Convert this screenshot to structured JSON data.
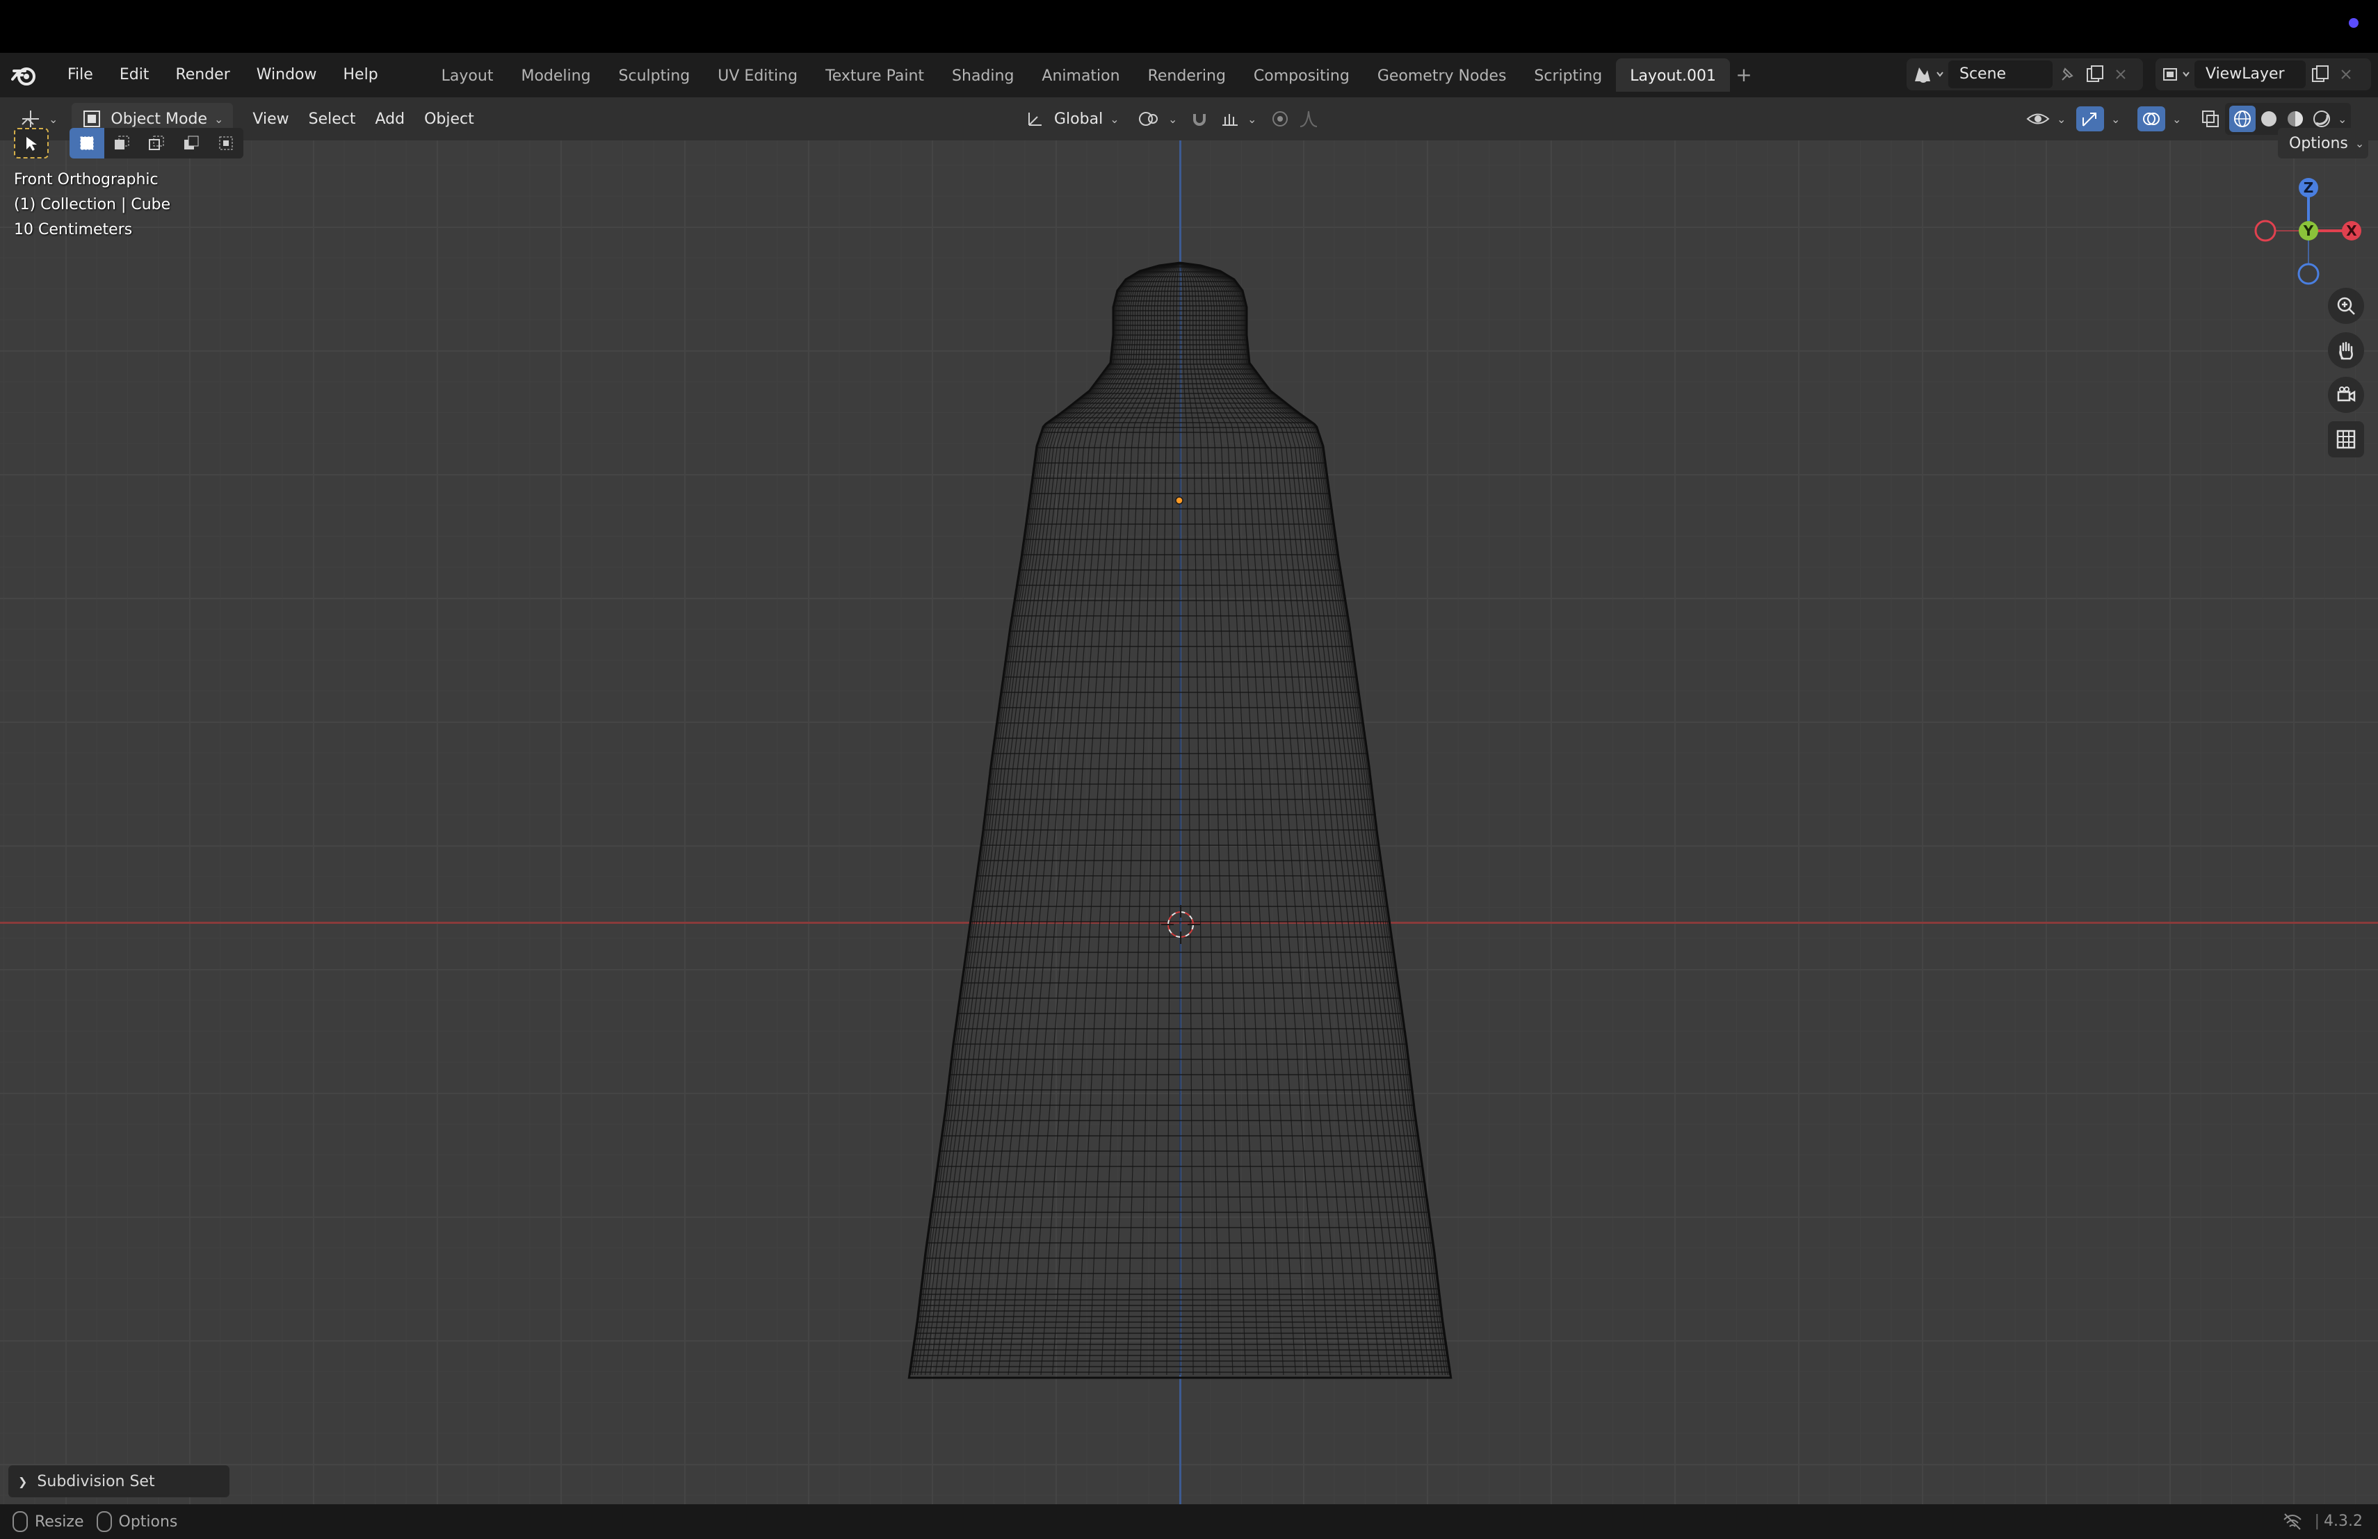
{
  "app": {
    "menu": [
      "File",
      "Edit",
      "Render",
      "Window",
      "Help"
    ],
    "workspaces": [
      "Layout",
      "Modeling",
      "Sculpting",
      "UV Editing",
      "Texture Paint",
      "Shading",
      "Animation",
      "Rendering",
      "Compositing",
      "Geometry Nodes",
      "Scripting",
      "Layout.001"
    ],
    "active_workspace": "Layout.001",
    "scene_name": "Scene",
    "view_layer": "ViewLayer"
  },
  "header": {
    "mode": "Object Mode",
    "menus": [
      "View",
      "Select",
      "Add",
      "Object"
    ],
    "transform_orientation": "Global",
    "options_label": "Options"
  },
  "viewport": {
    "view_name": "Front Orthographic",
    "collection_info": "(1) Collection | Cube",
    "grid_scale": "10 Centimeters",
    "gizmo_axes": {
      "z": "Z",
      "y": "Y",
      "x": "X"
    },
    "colors": {
      "x_axis": "#e1414f",
      "y_axis": "#8bc33a",
      "z_axis": "#4a7fe0",
      "origin": "#ff9b26"
    }
  },
  "operator_panel": {
    "label": "Subdivision Set"
  },
  "statusbar": {
    "resize_label": "Resize",
    "options_label": "Options",
    "version": "4.3.2"
  }
}
